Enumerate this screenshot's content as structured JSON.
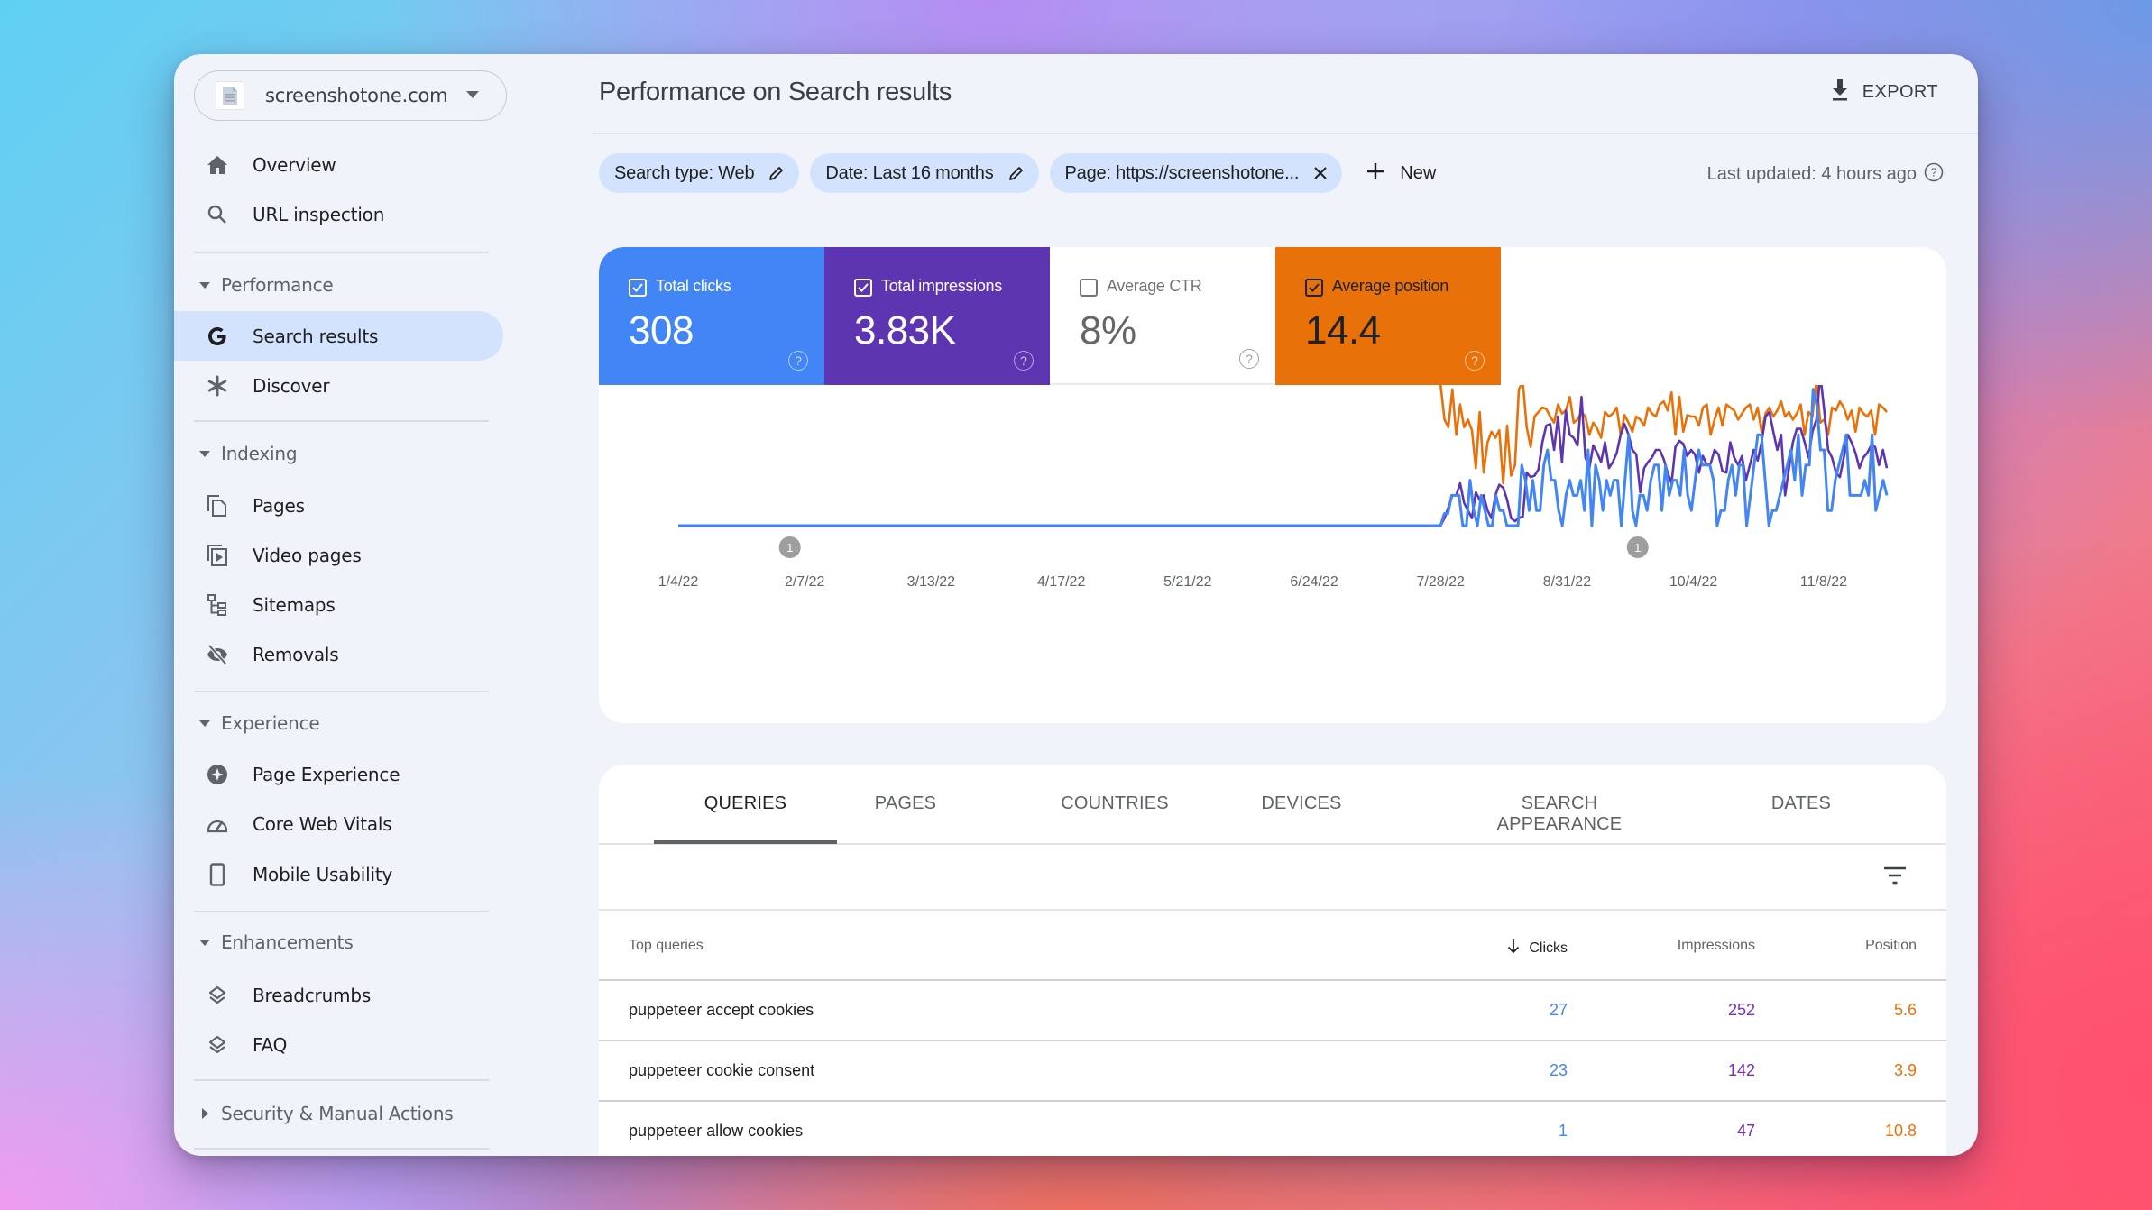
{
  "property": {
    "name": "screenshotone.com",
    "icon": "document-icon"
  },
  "sidebar": {
    "top_items": [
      {
        "label": "Overview",
        "icon": "home-icon"
      },
      {
        "label": "URL inspection",
        "icon": "search-icon"
      }
    ],
    "sections": [
      {
        "title": "Performance",
        "expanded": true,
        "items": [
          {
            "label": "Search results",
            "icon": "google-g-icon",
            "active": true
          },
          {
            "label": "Discover",
            "icon": "asterisk-icon"
          }
        ]
      },
      {
        "title": "Indexing",
        "expanded": true,
        "items": [
          {
            "label": "Pages",
            "icon": "pages-icon"
          },
          {
            "label": "Video pages",
            "icon": "video-pages-icon"
          },
          {
            "label": "Sitemaps",
            "icon": "sitemap-icon"
          },
          {
            "label": "Removals",
            "icon": "eye-off-icon"
          }
        ]
      },
      {
        "title": "Experience",
        "expanded": true,
        "items": [
          {
            "label": "Page Experience",
            "icon": "page-experience-icon"
          },
          {
            "label": "Core Web Vitals",
            "icon": "gauge-icon"
          },
          {
            "label": "Mobile Usability",
            "icon": "phone-icon"
          }
        ]
      },
      {
        "title": "Enhancements",
        "expanded": true,
        "items": [
          {
            "label": "Breadcrumbs",
            "icon": "layers-icon"
          },
          {
            "label": "FAQ",
            "icon": "layers-icon"
          }
        ]
      },
      {
        "title": "Security & Manual Actions",
        "expanded": false,
        "items": []
      }
    ]
  },
  "header": {
    "title": "Performance on Search results",
    "export_label": "EXPORT"
  },
  "filters": {
    "chips": [
      {
        "label": "Search type: Web",
        "action": "edit"
      },
      {
        "label": "Date: Last 16 months",
        "action": "edit"
      },
      {
        "label": "Page: https://screenshotone...",
        "action": "remove"
      }
    ],
    "new_label": "New",
    "last_updated": "Last updated: 4 hours ago"
  },
  "metrics": [
    {
      "label": "Total clicks",
      "value": "308",
      "checked": true,
      "color": "#4285f4"
    },
    {
      "label": "Total impressions",
      "value": "3.83K",
      "checked": true,
      "color": "#5e35b1"
    },
    {
      "label": "Average CTR",
      "value": "8%",
      "checked": false,
      "color": "#ffffff"
    },
    {
      "label": "Average position",
      "value": "14.4",
      "checked": true,
      "color": "#e8710a"
    }
  ],
  "chart_data": {
    "type": "line",
    "title": "",
    "xlabel": "",
    "ylabel": "",
    "x_tick_labels": [
      "1/4/22",
      "2/7/22",
      "3/13/22",
      "4/17/22",
      "5/21/22",
      "6/24/22",
      "7/28/22",
      "8/31/22",
      "10/4/22",
      "11/8/22"
    ],
    "x_range": [
      "1/4/22",
      "11/25/22"
    ],
    "y_axis_visible": false,
    "grid": false,
    "legend": "none",
    "annotations": [
      {
        "date": "2/3/22",
        "label": "1"
      },
      {
        "date": "9/19/22",
        "label": "1"
      }
    ],
    "note": "Values approximate, normalized 0-1 per series (each metric on its own hidden axis). Zero before ~7/28/22; daily values from 7/28/22 onward.",
    "series": [
      {
        "name": "Total clicks",
        "color": "#4285f4",
        "values": [
          0,
          0.08,
          0.08,
          0.2,
          0.2,
          0.2,
          0,
          0,
          0.3,
          0.1,
          0,
          0.2,
          0.1,
          0,
          0,
          0.2,
          0.1,
          0.1,
          0,
          0,
          0,
          0,
          0.4,
          0.3,
          0.1,
          0.3,
          0.1,
          0.1,
          0.4,
          0.5,
          0.3,
          0.3,
          0.1,
          0,
          0.2,
          0.3,
          0.2,
          0.2,
          0.3,
          0.1,
          0.5,
          0,
          0.4,
          0.3,
          0.1,
          0.3,
          0.2,
          0.3,
          0.3,
          0,
          0.3,
          0.6,
          0.1,
          0,
          0.2,
          0.2,
          0.1,
          0.3,
          0.4,
          0.4,
          0.1,
          0.4,
          0.2,
          0.3,
          0.3,
          0.2,
          0.5,
          0.2,
          0.1,
          0.3,
          0.5,
          0.4,
          0.4,
          0.4,
          0.3,
          0,
          0.1,
          0.1,
          0.3,
          0.4,
          0.2,
          0.4,
          0.4,
          0,
          0.2,
          0.4,
          0.6,
          0.6,
          0.3,
          0,
          0.1,
          0.1,
          0.2,
          0.3,
          0.4,
          0.5,
          0.3,
          0.6,
          0.2,
          0.4,
          0.4,
          0.9,
          0.8,
          0.5,
          0.5,
          0.1,
          0.1,
          0.3,
          0.4,
          0.5,
          0.6,
          0.2,
          0.2,
          0.2,
          0.2,
          0.3,
          0.2,
          0.6,
          0.1,
          0.2,
          0.3,
          0.2
        ]
      },
      {
        "name": "Total impressions",
        "color": "#5e35b1",
        "values": [
          0,
          0.05,
          0.12,
          0.2,
          0.2,
          0.28,
          0.15,
          0.1,
          0.05,
          0.22,
          0.17,
          0.2,
          0.1,
          0.05,
          0.2,
          0.27,
          0.25,
          0.17,
          0.05,
          0.03,
          0.05,
          0.06,
          0.35,
          0.32,
          0.33,
          0.37,
          0.55,
          0.66,
          0.67,
          0.5,
          0.72,
          0.42,
          0.76,
          0.6,
          0.58,
          0.53,
          0.85,
          0.45,
          0.38,
          0.53,
          0.48,
          0.42,
          0.55,
          0.38,
          0.42,
          0.48,
          0.6,
          0.67,
          0.6,
          0.5,
          0.47,
          0.22,
          0.38,
          0.42,
          0.45,
          0.5,
          0.5,
          0.44,
          0.35,
          0.28,
          0.52,
          0.56,
          0.54,
          0.46,
          0.5,
          0.47,
          0.35,
          0.46,
          0.4,
          0.41,
          0.5,
          0.47,
          0.36,
          0.35,
          0.55,
          0.45,
          0.4,
          0.46,
          0.3,
          0.4,
          0.5,
          0.43,
          0.55,
          0.72,
          0.75,
          0.62,
          0.5,
          0.6,
          0.2,
          0.38,
          0.55,
          0.64,
          0.64,
          0.55,
          0.45,
          0.62,
          0.7,
          1.0,
          0.76,
          0.5,
          0.45,
          0.35,
          0.32,
          0.45,
          0.6,
          0.55,
          0.48,
          0.38,
          0.45,
          0.48,
          0.53,
          0.52,
          0.4,
          0.5,
          0.38
        ]
      },
      {
        "name": "Average position",
        "color": "#e8710a",
        "values": [
          0.93,
          0.7,
          0.65,
          0.9,
          0.6,
          0.8,
          0.65,
          0.7,
          0.63,
          0.38,
          0.75,
          0.35,
          0.55,
          0.62,
          0.58,
          0.63,
          0.28,
          0.66,
          0.33,
          0.4,
          0.9,
          0.95,
          0.65,
          0.52,
          0.72,
          0.75,
          0.78,
          0.77,
          0.72,
          0.68,
          0.8,
          0.74,
          0.76,
          0.85,
          0.68,
          0.7,
          0.75,
          0.72,
          0.6,
          0.68,
          0.64,
          0.58,
          0.75,
          0.72,
          0.74,
          0.78,
          0.6,
          0.73,
          0.68,
          0.62,
          0.72,
          0.7,
          0.66,
          0.78,
          0.74,
          0.72,
          0.8,
          0.82,
          0.76,
          0.88,
          0.6,
          0.85,
          0.62,
          0.73,
          0.72,
          0.72,
          0.66,
          0.78,
          0.8,
          0.6,
          0.7,
          0.78,
          0.66,
          0.8,
          0.78,
          0.76,
          0.7,
          0.74,
          0.78,
          0.8,
          0.7,
          0.78,
          0.62,
          0.74,
          0.78,
          0.72,
          0.76,
          0.82,
          0.72,
          0.75,
          0.7,
          0.74,
          0.8,
          0.6,
          0.75,
          0.72,
          0.96,
          0.68,
          0.7,
          0.6,
          0.78,
          0.76,
          0.82,
          0.78,
          0.7,
          0.76,
          0.62,
          0.78,
          0.74,
          0.72,
          0.76,
          0.6,
          0.8,
          0.78,
          0.75
        ]
      }
    ]
  },
  "table": {
    "tabs": [
      "QUERIES",
      "PAGES",
      "COUNTRIES",
      "DEVICES",
      "SEARCH APPEARANCE",
      "DATES"
    ],
    "active_tab": "QUERIES",
    "columns": [
      "Top queries",
      "Clicks",
      "Impressions",
      "Position"
    ],
    "sorted_column": "Clicks",
    "sort_direction": "descending",
    "rows": [
      {
        "query": "puppeteer accept cookies",
        "clicks": "27",
        "impressions": "252",
        "position": "5.6"
      },
      {
        "query": "puppeteer cookie consent",
        "clicks": "23",
        "impressions": "142",
        "position": "3.9"
      },
      {
        "query": "puppeteer allow cookies",
        "clicks": "1",
        "impressions": "47",
        "position": "10.8"
      }
    ]
  }
}
